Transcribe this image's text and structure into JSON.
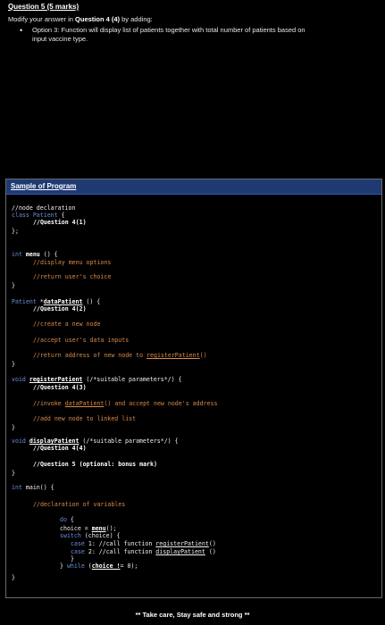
{
  "question": {
    "title": "Question 5 (5 marks)",
    "modify_prefix": "Modify your answer in ",
    "modify_bold": "Question 4 (4)",
    "modify_suffix": " by adding:",
    "bullet_line1": "Option 3: Function will display list of patients together with total number of patients based on",
    "bullet_line2": "input vaccine type."
  },
  "sample": {
    "header": "Sample of Program",
    "code": {
      "l1": "//node declaration",
      "l2a": "class ",
      "l2b": "Patient",
      "l2c": " {",
      "l3": "//Question 4(1)",
      "l4": "};",
      "l5a": "int ",
      "l5b": "menu",
      "l5c": " () {",
      "l6": "//display menu options",
      "l7": "//return user's choice",
      "l8": "}",
      "l9a": "Patient ",
      "l9b": "*",
      "l9c": "dataPatient",
      "l9d": " () {",
      "l10": "//Question 4(2)",
      "l11": "//create a new node",
      "l12": "//accept user's data inputs",
      "l13a": "//return address of new node to ",
      "l13b": "registerPatient",
      "l13c": "()",
      "l14": "}",
      "l15a": "void ",
      "l15b": "registerPatient",
      "l15c": " (/*suitable parameters*/) {",
      "l16": "//Question 4(3)",
      "l17a": "//invoke ",
      "l17b": "dataPatient",
      "l17c": "() and accept new node's address",
      "l18": "//add new node to linked list",
      "l19": "}",
      "l20a": "void ",
      "l20b": "displayPatient",
      "l20c": " (/*suitable parameters*/) {",
      "l21": "//Question 4(4)",
      "l22": "//Question 5 (optional: bonus mark)",
      "l23": "}",
      "l24a": "int ",
      "l24b": "main() {",
      "l25": "//declaration of variables",
      "l26a": "do",
      "l26b": " {",
      "l27a": "choice = ",
      "l27b": "menu",
      "l27c": "();",
      "l28a": "switch",
      "l28b": " (choice) {",
      "l29a": "case",
      "l29b": " 1: //call function ",
      "l29c": "registerPatient",
      "l29d": "()",
      "l30a": "case",
      "l30b": " 2: //call function ",
      "l30c": "displayPatient",
      "l30d": " ()",
      "l31": "}",
      "l32a": "} ",
      "l32b": "while",
      "l32c": " (",
      "l32d": "choice !",
      "l32e": "= 0);",
      "l33": "}"
    }
  },
  "footer": "** Take care, Stay safe and strong **"
}
